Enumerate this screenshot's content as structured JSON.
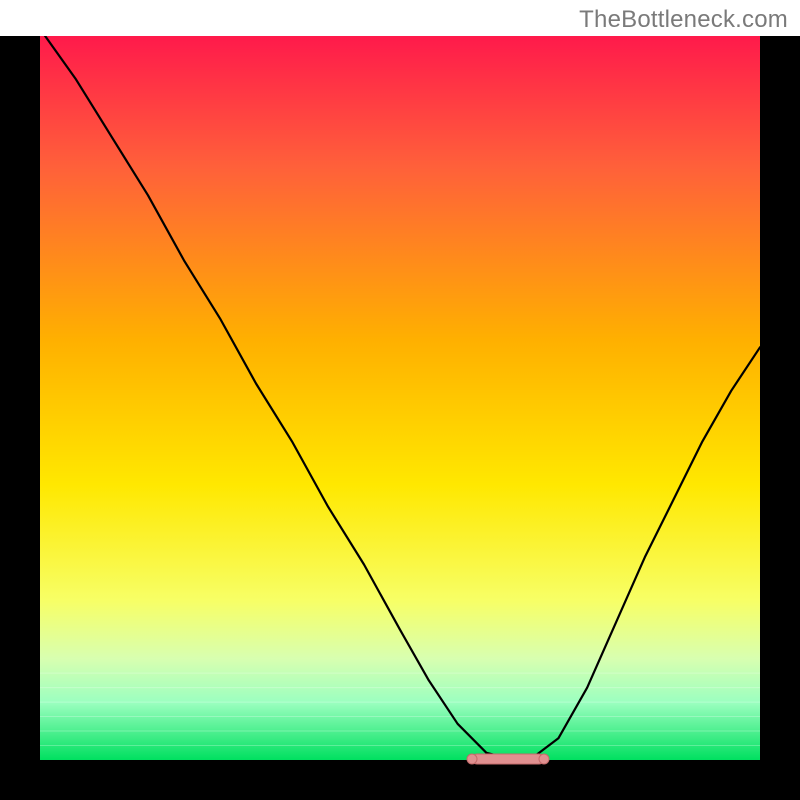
{
  "watermark": "TheBottleneck.com",
  "colors": {
    "border": "#000000",
    "top": "#ff1a4b",
    "mid1": "#ff603a",
    "mid2": "#ffb000",
    "mid3": "#ffe800",
    "low1": "#f7ff66",
    "low2": "#d8ffb0",
    "bottom_band_top": "#9cffc0",
    "bottom_band_bot": "#00e060",
    "curve": "#000000",
    "marker_fill": "#e09090",
    "marker_stroke": "#c46a6a"
  },
  "chart_data": {
    "type": "line",
    "title": "",
    "xlabel": "",
    "ylabel": "",
    "xlim": [
      0,
      100
    ],
    "ylim": [
      0,
      100
    ],
    "x": [
      0,
      5,
      10,
      15,
      20,
      25,
      30,
      35,
      40,
      45,
      50,
      54,
      58,
      62,
      66,
      68,
      72,
      76,
      80,
      84,
      88,
      92,
      96,
      100
    ],
    "values": [
      101,
      94,
      86,
      78,
      69,
      61,
      52,
      44,
      35,
      27,
      18,
      11,
      5,
      1,
      0,
      0,
      3,
      10,
      19,
      28,
      36,
      44,
      51,
      57
    ],
    "flat_segment": {
      "x_start": 60,
      "x_end": 70,
      "y": 0
    }
  }
}
